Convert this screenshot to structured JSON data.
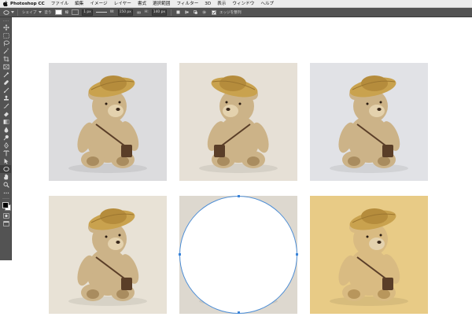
{
  "menubar": {
    "app_name": "Photoshop CC",
    "items": [
      "ファイル",
      "編集",
      "イメージ",
      "レイヤー",
      "書式",
      "選択範囲",
      "フィルター",
      "3D",
      "表示",
      "ウィンドウ",
      "ヘルプ"
    ]
  },
  "options_bar": {
    "mode": "シェイプ",
    "fill_label": "塗り",
    "stroke_label": "線",
    "stroke_width": "1 px",
    "width_label": "W:",
    "width_value": "150 px",
    "height_label": "H:",
    "height_value": "140 px",
    "align_edges_label": "エッジを整列"
  },
  "colors": {
    "app_chrome": "#535353",
    "menubar": "#ececec",
    "selection_blue": "#3a84d9",
    "foreground": "#000000",
    "background": "#ffffff"
  },
  "canvas": {
    "photos": [
      {
        "name": "teddy-bear-photo-1",
        "bg": "#dcdcde"
      },
      {
        "name": "teddy-bear-photo-2",
        "bg": "#e6e0d6"
      },
      {
        "name": "teddy-bear-photo-3",
        "bg": "#e1e2e6"
      },
      {
        "name": "teddy-bear-photo-4",
        "bg": "#e8e2d6"
      },
      {
        "name": "teddy-bear-photo-5",
        "bg": "#ddd8cf",
        "covered_by": "ellipse-shape"
      },
      {
        "name": "teddy-bear-photo-6",
        "bg": "#e8cb86"
      }
    ],
    "shape": {
      "type": "ellipse",
      "fill": "#ffffff",
      "selected": true
    }
  }
}
